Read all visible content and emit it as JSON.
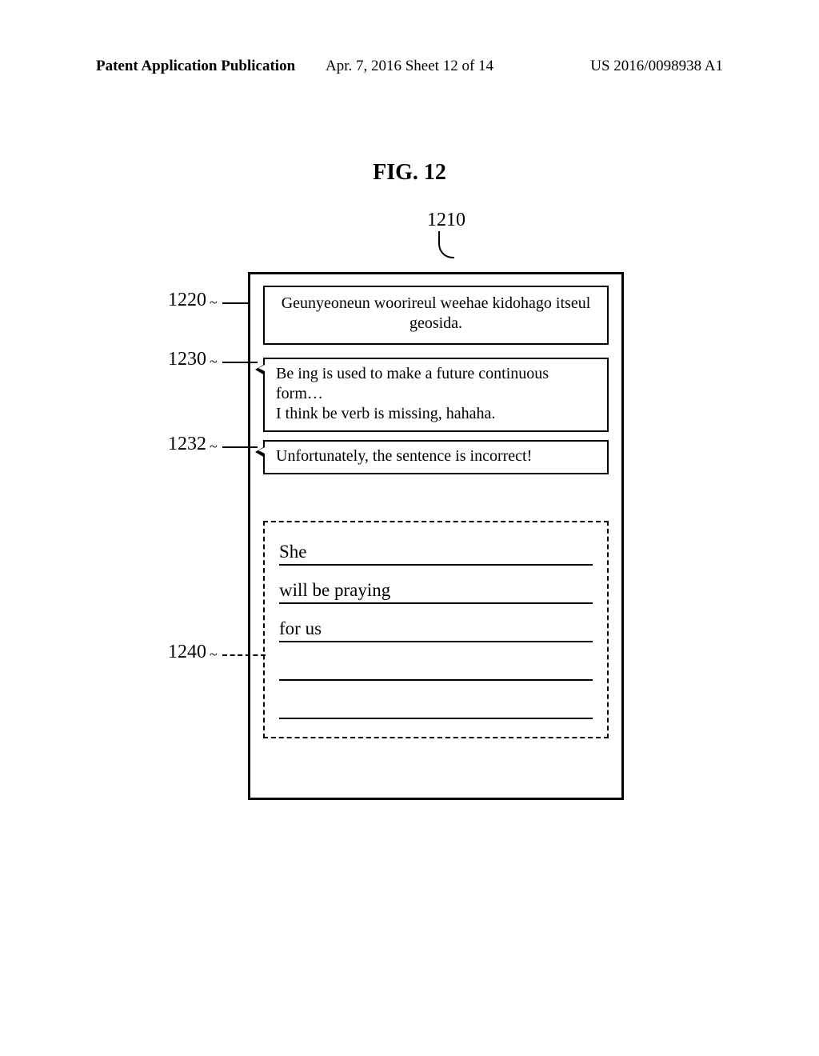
{
  "header": {
    "left": "Patent Application Publication",
    "center": "Apr. 7, 2016  Sheet 12 of 14",
    "right": "US 2016/0098938 A1"
  },
  "figure": {
    "title": "FIG. 12",
    "refs": {
      "device": "1210",
      "prompt": "1220",
      "bubble1": "1230",
      "bubble2": "1232",
      "answer": "1240"
    },
    "prompt_text": "Geunyeoneun woorireul weehae kidohago itseul geosida.",
    "bubble1_line1": "Be ing is used to make a future continuous",
    "bubble1_line2": "form…",
    "bubble1_line3": "I think be verb is missing, hahaha.",
    "bubble2_text": "Unfortunately, the sentence is incorrect!",
    "answers": {
      "a1": "She",
      "a2": "will be praying",
      "a3": "for us",
      "a4": "",
      "a5": ""
    }
  }
}
